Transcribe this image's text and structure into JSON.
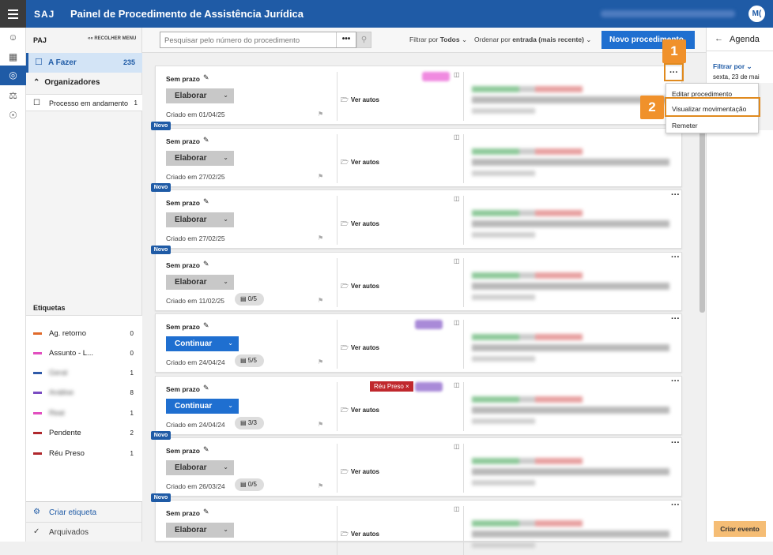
{
  "app": {
    "brand": "SAJ",
    "title": "Painel de Procedimento de Assistência Jurídica",
    "avatar": "M("
  },
  "sidebar": {
    "section": "PAJ",
    "collapse": "RECOLHER MENU",
    "afazer": {
      "label": "A Fazer",
      "count": "235"
    },
    "organizadores": "Organizadores",
    "processo": {
      "label": "Processo em andamento",
      "count": "1"
    },
    "etiquetas_title": "Etiquetas",
    "tags": [
      {
        "label": "Ag. retorno",
        "count": "0",
        "color": "#e06a2b"
      },
      {
        "label": "Assunto - L...",
        "count": "0",
        "color": "#e24fbf"
      },
      {
        "label": "Geral",
        "count": "1",
        "color": "#2f5aa8"
      },
      {
        "label": "Análise",
        "count": "8",
        "color": "#7a4cc2"
      },
      {
        "label": "Real",
        "count": "1",
        "color": "#e24fbf"
      },
      {
        "label": "Pendente",
        "count": "2",
        "color": "#b0282d"
      },
      {
        "label": "Réu Preso",
        "count": "1",
        "color": "#b0282d"
      }
    ],
    "criar": "Criar etiqueta",
    "arquivados": "Arquivados"
  },
  "toolbar": {
    "search_placeholder": "Pesquisar pelo número do procedimento",
    "dots": "•••",
    "filter_prefix": "Filtrar por ",
    "filter_value": "Todos",
    "order_prefix": "Ordenar por ",
    "order_value": "entrada (mais recente)",
    "new_button": "Novo procedimento"
  },
  "cards": [
    {
      "prazo": "Sem prazo",
      "action": "Elaborar",
      "created": "Criado em 01/04/25",
      "docs": "",
      "autos": "Ver autos",
      "novo": false,
      "tag": ""
    },
    {
      "prazo": "Sem prazo",
      "action": "Elaborar",
      "created": "Criado em 27/02/25",
      "docs": "",
      "autos": "Ver autos",
      "novo": true,
      "tag": ""
    },
    {
      "prazo": "Sem prazo",
      "action": "Elaborar",
      "created": "Criado em 27/02/25",
      "docs": "",
      "autos": "Ver autos",
      "novo": true,
      "tag": ""
    },
    {
      "prazo": "Sem prazo",
      "action": "Elaborar",
      "created": "Criado em 11/02/25",
      "docs": "0/5",
      "autos": "Ver autos",
      "novo": true,
      "tag": ""
    },
    {
      "prazo": "Sem prazo",
      "action": "Continuar",
      "created": "Criado em 24/04/24",
      "docs": "5/5",
      "autos": "Ver autos",
      "novo": false,
      "tag": ""
    },
    {
      "prazo": "Sem prazo",
      "action": "Continuar",
      "created": "Criado em 24/04/24",
      "docs": "3/3",
      "autos": "Ver autos",
      "novo": false,
      "tag": "Réu Preso"
    },
    {
      "prazo": "Sem prazo",
      "action": "Elaborar",
      "created": "Criado em 26/03/24",
      "docs": "0/5",
      "autos": "Ver autos",
      "novo": true,
      "tag": ""
    },
    {
      "prazo": "Sem prazo",
      "action": "Elaborar",
      "created": "",
      "docs": "",
      "autos": "Ver autos",
      "novo": true,
      "tag": ""
    }
  ],
  "novo_label": "Novo",
  "popup": {
    "items": [
      "Editar procedimento",
      "Visualizar movimentação",
      "Remeter"
    ]
  },
  "agenda": {
    "title": "Agenda",
    "filter": "Filtrar por",
    "date": "sexta, 23 de mai",
    "create": "Criar evento"
  },
  "callouts": {
    "one": "1",
    "two": "2"
  },
  "colors": {
    "primary": "#1f5ba6",
    "accent": "#f0912b",
    "button": "#1f6fd0"
  }
}
